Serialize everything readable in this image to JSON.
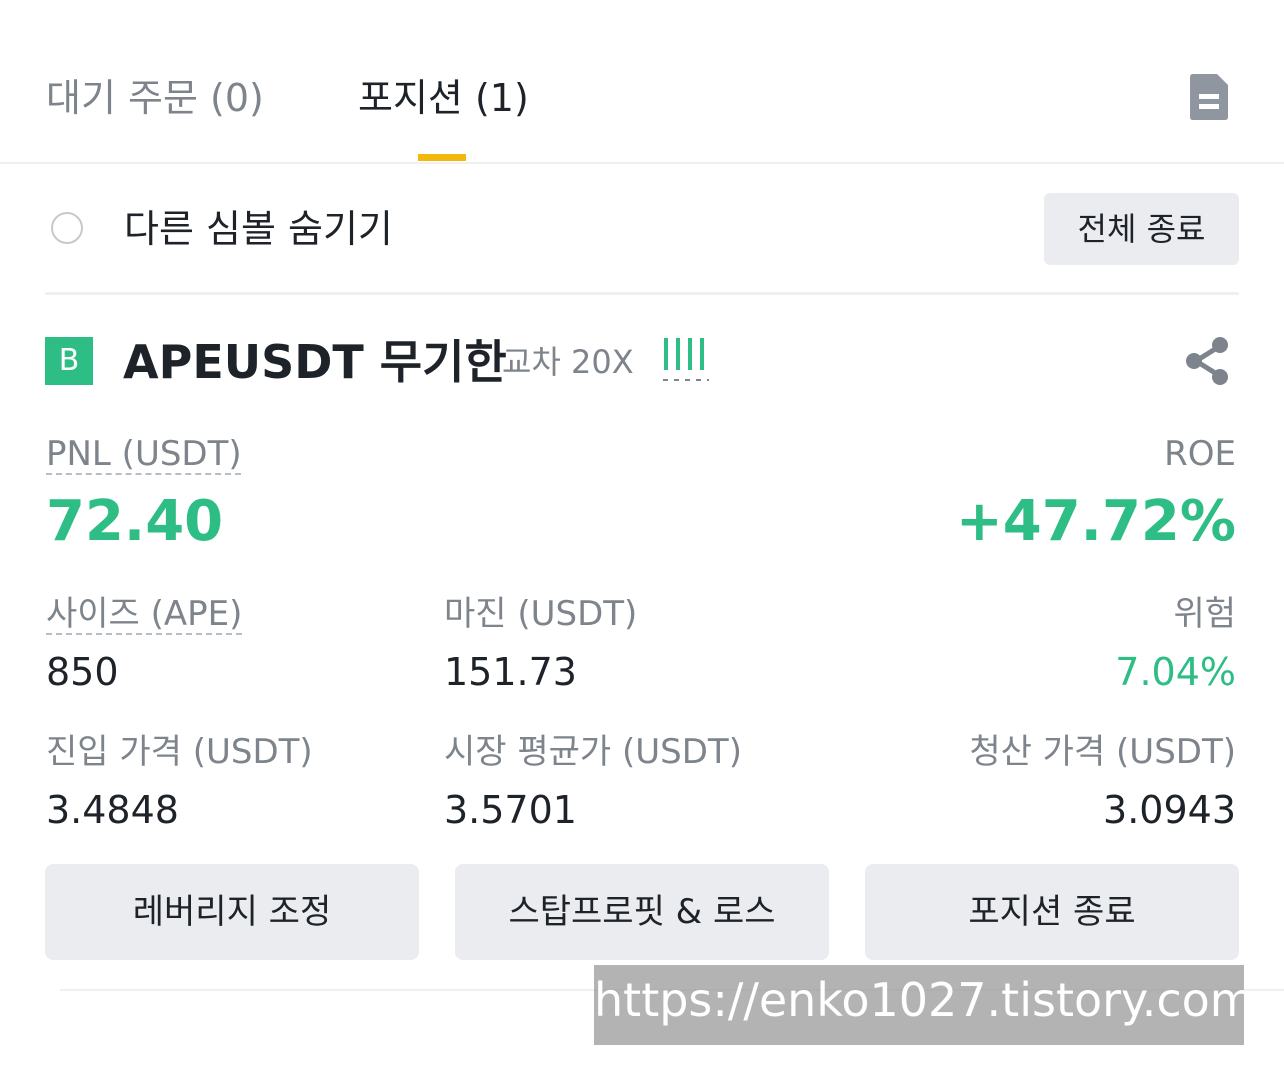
{
  "tabs": {
    "open_orders": "대기 주문 (0)",
    "positions": "포지션 (1)"
  },
  "icons": {
    "doc": "document-icon",
    "share": "share-icon",
    "leverage_bars": "leverage-bars-icon"
  },
  "filter": {
    "hide_other_symbols": "다른 심볼 숨기기",
    "close_all": "전체 종료"
  },
  "position": {
    "side_badge": "B",
    "symbol": "APEUSDT 무기한",
    "margin_mode": "교차 20X",
    "pnl_label": "PNL (USDT)",
    "pnl_value": "72.40",
    "roe_label": "ROE",
    "roe_value": "+47.72%",
    "size_label": "사이즈 (APE)",
    "size_value": "850",
    "margin_label": "마진 (USDT)",
    "margin_value": "151.73",
    "risk_label": "위험",
    "risk_value": "7.04%",
    "entry_label": "진입 가격 (USDT)",
    "entry_value": "3.4848",
    "mark_label": "시장 평균가 (USDT)",
    "mark_value": "3.5701",
    "liq_label": "청산 가격 (USDT)",
    "liq_value": "3.0943"
  },
  "actions": {
    "leverage": "레버리지 조정",
    "tpsl": "스탑프로핏 & 로스",
    "close": "포지션 종료"
  },
  "watermark": "https://enko1027.tistory.com",
  "colors": {
    "accent": "#f0b90b",
    "positive": "#2ebd85",
    "text": "#1e2329",
    "muted": "#7e848c",
    "button_bg": "#eaecef"
  }
}
